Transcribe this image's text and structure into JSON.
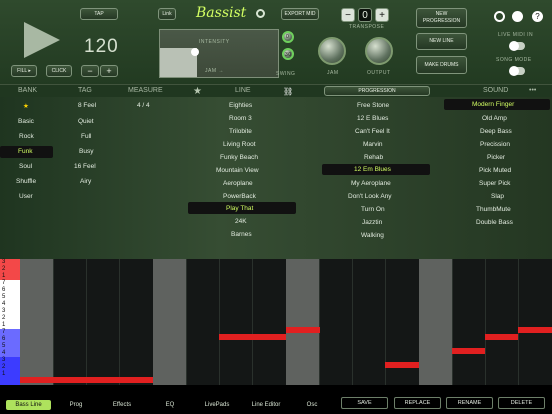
{
  "header": {
    "tap": "TAP",
    "link": "Link",
    "export": "EXPORT MID",
    "newProgression": "NEW\nPROGRESSION",
    "newLine": "NEW LINE",
    "makeDrums": "MAKE DRUMS",
    "tempo": "120",
    "fill": "FILL ▸",
    "click": "CLICK",
    "minus": "−",
    "plus": "+",
    "transposeValue": "0",
    "transposeLabel": "TRANSPOSE",
    "intensity": "INTENSITY",
    "jam": "JAM →",
    "swing": "SWING",
    "jamKnob": "JAM",
    "output": "OUTPUT",
    "swing1": "0",
    "swing2": "30",
    "liveMidiIn": "LIVE MIDI IN",
    "songMode": "SONG MODE",
    "logo": "Bassist"
  },
  "columns": {
    "bank": "BANK",
    "tag": "TAG",
    "measure": "MEASURE",
    "line": "LINE",
    "progression": "PROGRESSION",
    "sound": "SOUND",
    "more": "•••"
  },
  "bank": [
    "★",
    "Basic",
    "Rock",
    "Funk",
    "Soul",
    "Shuffle",
    "User"
  ],
  "tag": [
    "8 Feel",
    "Quiet",
    "Full",
    "Busy",
    "16 Feel",
    "Airy"
  ],
  "measure": "4 / 4",
  "lines": [
    "Eighties",
    "Room 3",
    "Trilobite",
    "Living Root",
    "Funky Beach",
    "Mountain View",
    "Aeroplane",
    "PowerBack",
    "Play That",
    "24K",
    "Barnes"
  ],
  "progressions": [
    "Free Stone",
    "12 E Blues",
    "Can't Feel It",
    "Marvin",
    "Rehab",
    "12 Em Blues",
    "My Aeroplane",
    "Don't Look Any",
    "Turn On",
    "Jazztin",
    "Walking"
  ],
  "sounds": [
    "Modern Finger",
    "Old Amp",
    "Deep Bass",
    "Precission",
    "Picker",
    "Pick Muted",
    "Super Pick",
    "Slap",
    "ThumbMute",
    "Double Bass"
  ],
  "gridRows": [
    "3",
    "2",
    "1",
    "7",
    "6",
    "5",
    "4",
    "3",
    "2",
    "1",
    "7",
    "6",
    "5",
    "4",
    "3",
    "2",
    "1"
  ],
  "tabs": [
    "Bass Line",
    "Prog",
    "Effects",
    "EQ",
    "LivePads",
    "Line Editor",
    "Osc"
  ],
  "actions": [
    "SAVE",
    "REPLACE",
    "RENAME",
    "DELETE"
  ],
  "colors": {
    "accent": "#d3ff63",
    "selected": "#aee25d",
    "note": "#e12020",
    "background": "#0f1710"
  }
}
